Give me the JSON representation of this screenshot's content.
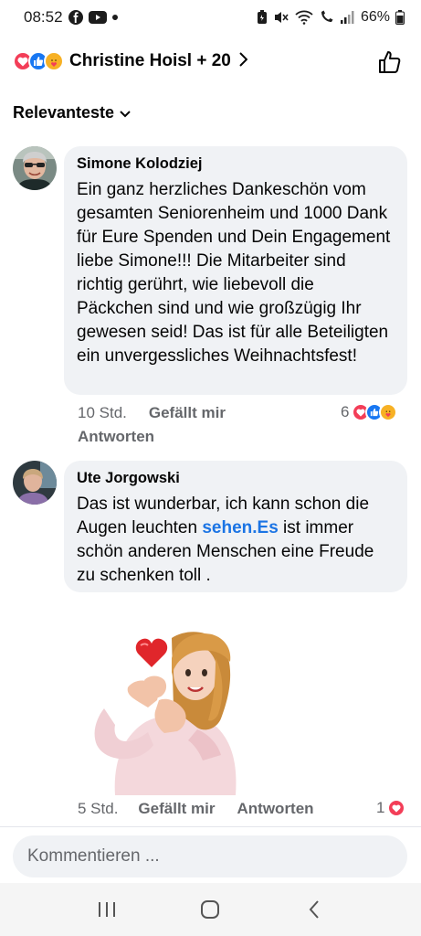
{
  "status": {
    "time": "08:52",
    "battery": "66%"
  },
  "reactions_header": {
    "names": "Christine Hoisl + 20",
    "icons": [
      "love-icon",
      "like-icon",
      "care-icon"
    ]
  },
  "sort": {
    "label": "Relevanteste"
  },
  "comments": [
    {
      "author": "Simone Kolodziej",
      "text": "Ein ganz herzliches Dankeschön vom gesamten Seniorenheim und 1000 Dank für Eure Spenden und Dein Engagement liebe Simone!!! Die Mitarbeiter sind richtig gerührt, wie liebevoll die Päckchen sind und wie großzügig Ihr gewesen seid! Das ist für alle Beteiligten ein unvergessliches Weihnachtsfest!",
      "time": "10 Std.",
      "like_label": "Gefällt mir",
      "reply_label": "Antworten",
      "reaction_count": "6"
    },
    {
      "author": "Ute Jorgowski",
      "text_before": "Das ist wunderbar, ich kann schon die Augen leuchten ",
      "link": "sehen.Es",
      "text_after": " ist immer schön anderen Menschen eine Freude zu schenken toll .",
      "time": "5 Std.",
      "like_label": "Gefällt mir",
      "reply_label": "Antworten",
      "reaction_count": "1"
    }
  ],
  "composer": {
    "placeholder": "Kommentieren ..."
  },
  "colors": {
    "bubble": "#f0f2f5",
    "link": "#1b74e4",
    "love": "#f33e58",
    "like": "#1877f2",
    "care": "#f7b125"
  }
}
